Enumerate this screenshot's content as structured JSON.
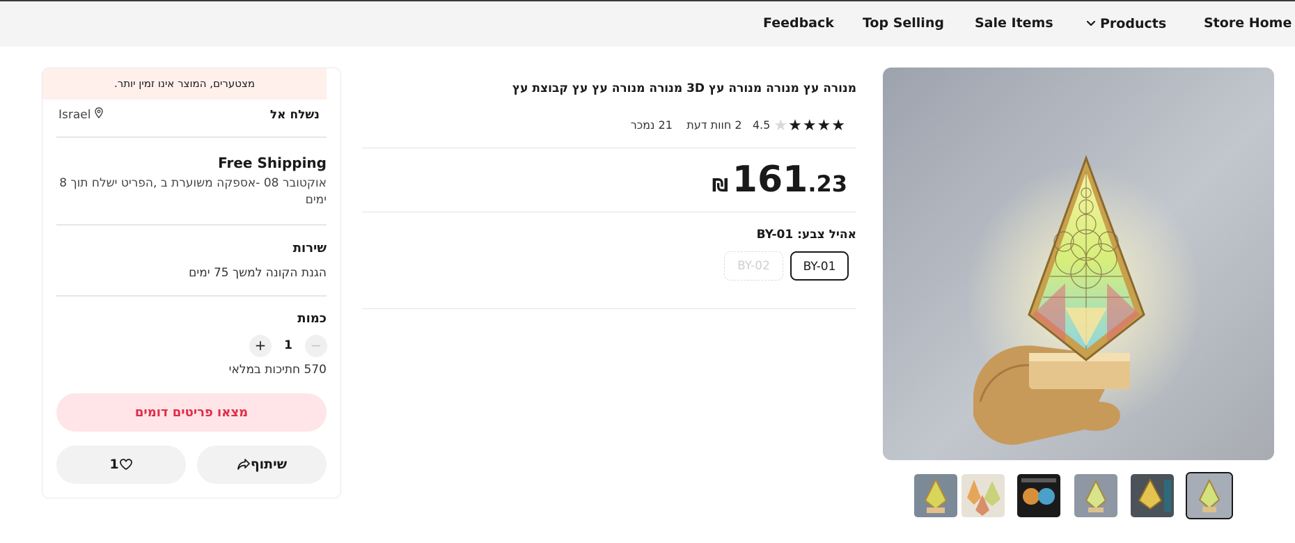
{
  "nav": {
    "feedback": "Feedback",
    "top_selling": "Top Selling",
    "sale_items": "Sale Items",
    "products": "Products",
    "store_home": "Store Home"
  },
  "panel": {
    "notice": "מצטערים, המוצר אינו זמין יותר.",
    "ship_to_label": "נשלח אל",
    "ship_to_location": "Israel",
    "shipping_title": "Free Shipping",
    "shipping_desc": "אוקטובר 08 -אספקה משוערת ב ,הפריט ישלח תוך 8 ימים",
    "service_title": "שירות",
    "service_desc": "הגנת הקונה למשך 75 ימים",
    "quantity_title": "כמות",
    "quantity_value": "1",
    "quantity_available": "570 חתיכות במלאי",
    "similar_button": "מצאו פריטים דומים",
    "like_count": "1",
    "share_label": "שיתוף"
  },
  "product": {
    "title": "מנורה עץ מנורה מנורה עץ 3D מנורה מנורה עץ עץ קבוצת עץ",
    "rating": "4.5",
    "reviews": "2 חוות דעת",
    "sold": "21 נמכר",
    "price_currency": "₪",
    "price_integer": "161",
    "price_decimal": ".23",
    "color_label": "אהיל צבע: BY-01",
    "variants": [
      "BY-01",
      "BY-02"
    ]
  },
  "colors": {
    "accent": "#e02c48",
    "notice_bg": "#fff0ec",
    "similar_bg": "#ffe5e7"
  }
}
